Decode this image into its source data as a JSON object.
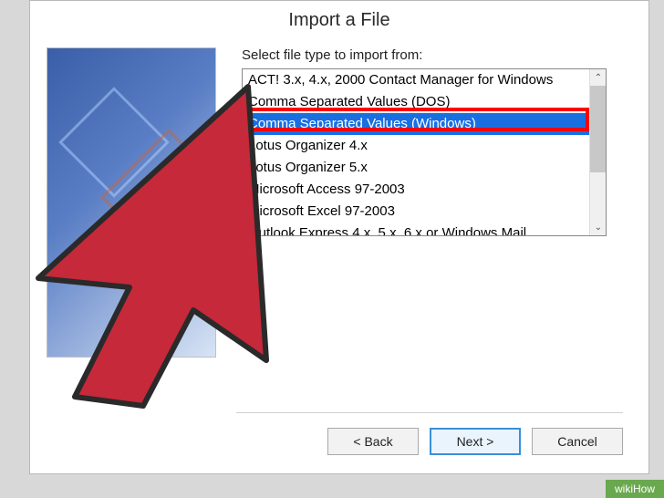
{
  "dialog": {
    "title": "Import a File",
    "prompt": "Select file type to import from:",
    "items": [
      "ACT! 3.x, 4.x, 2000 Contact Manager for Windows",
      "Comma Separated Values (DOS)",
      "Comma Separated Values (Windows)",
      "Lotus Organizer 4.x",
      "Lotus Organizer 5.x",
      "Microsoft Access 97-2003",
      "Microsoft Excel 97-2003",
      "Outlook Express 4.x, 5.x, 6.x or Windows Mail"
    ],
    "selected_index": 2
  },
  "buttons": {
    "back": "< Back",
    "next": "Next >",
    "cancel": "Cancel"
  },
  "watermark": "wikiHow",
  "scroll": {
    "up": "⌃",
    "down": "⌄"
  }
}
